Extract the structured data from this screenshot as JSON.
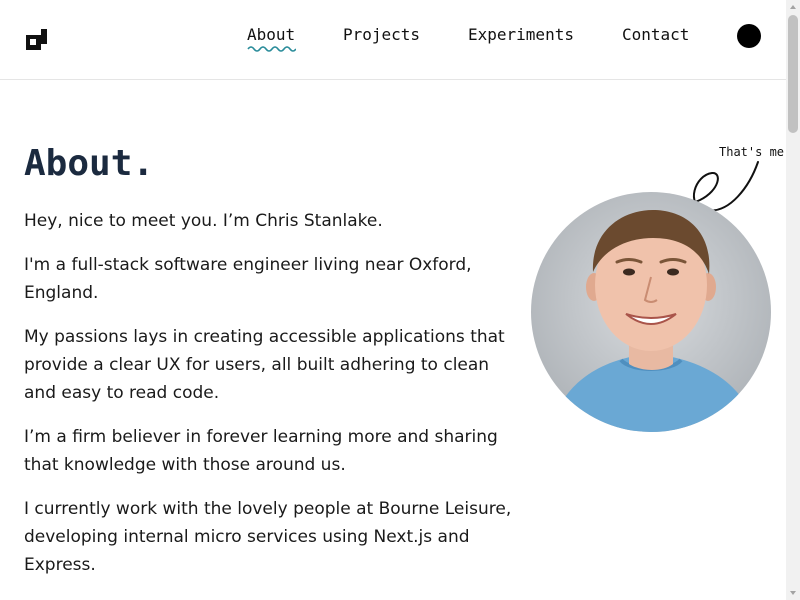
{
  "nav": {
    "about": "About",
    "projects": "Projects",
    "experiments": "Experiments",
    "contact": "Contact"
  },
  "theme_toggle_icon": "dark-mode-circle-icon",
  "logo_icon": "pixel-square-logo",
  "page": {
    "title": "About.",
    "paragraphs": [
      "Hey, nice to meet you. I’m Chris Stanlake.",
      "I'm a full-stack software engineer living near Oxford, England.",
      "My passions lays in creating accessible applications that provide a clear UX for users, all built adhering to clean and easy to read code.",
      "I’m a firm believer in forever learning more and sharing that knowledge with those around us.",
      "I currently work with the lovely people at Bourne Leisure, developing internal micro services using Next.js and Express."
    ]
  },
  "annotation": {
    "label": "That's me"
  },
  "colors": {
    "title": "#1b2a3f",
    "nav_underline": "#2a8c9a",
    "text": "#1a1a1a",
    "border": "#e5e5e5",
    "shirt": "#6aa8d4"
  }
}
